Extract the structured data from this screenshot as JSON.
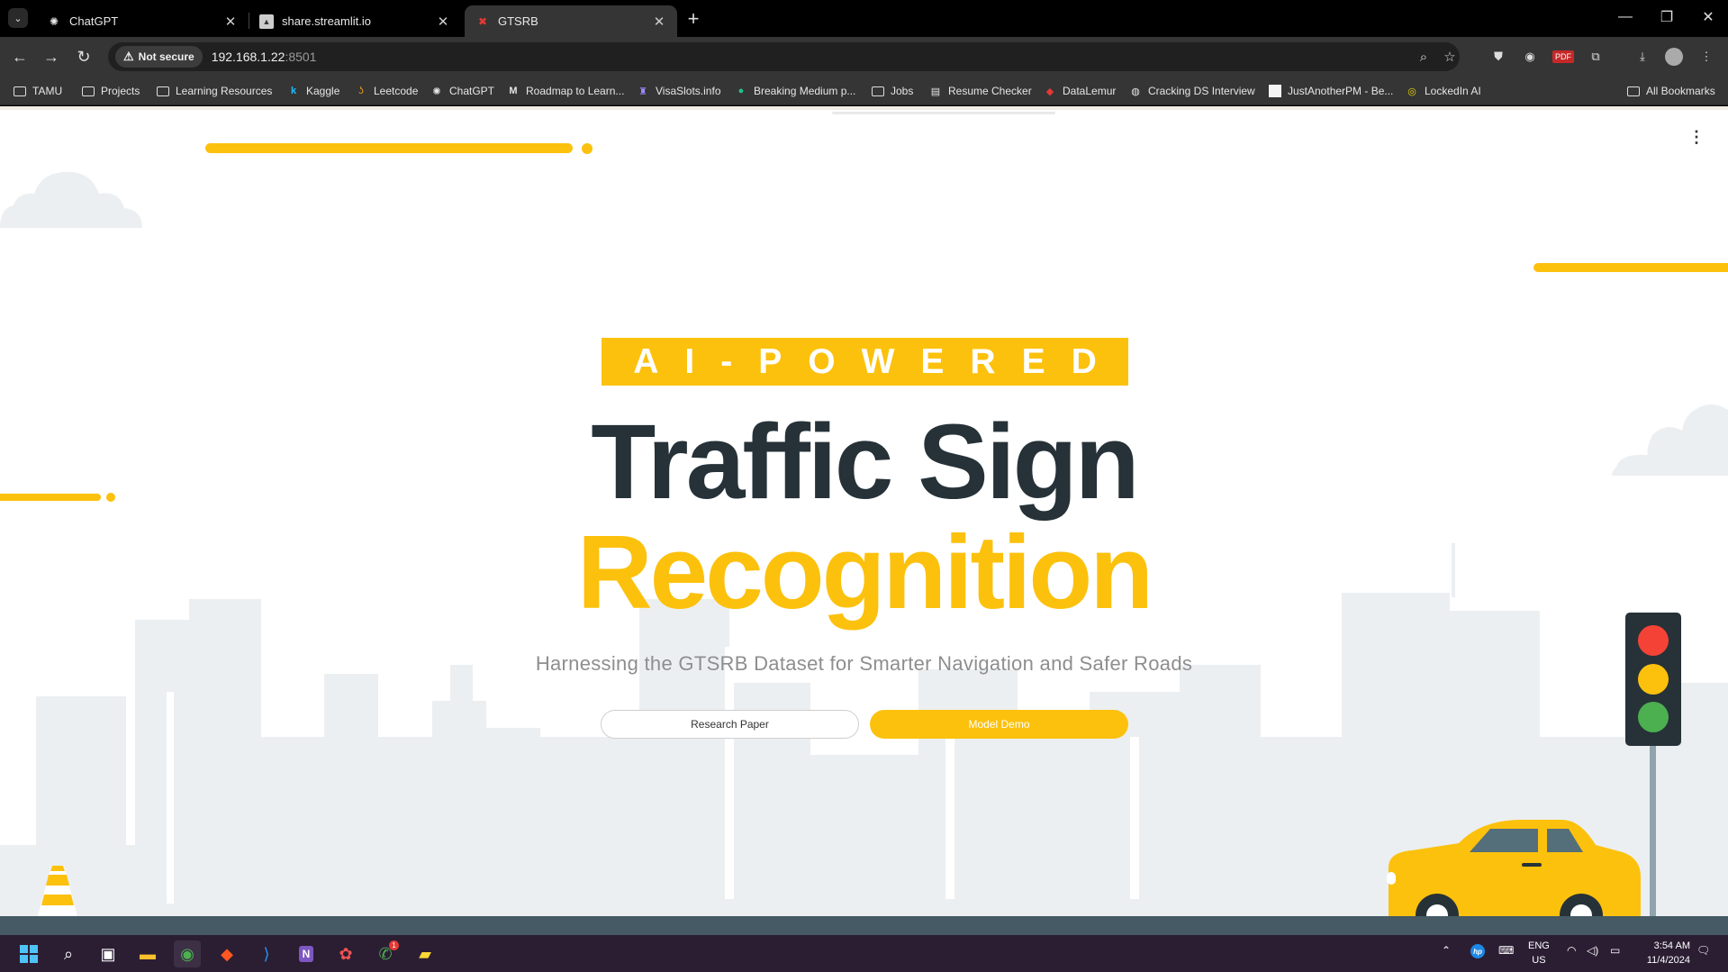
{
  "browser": {
    "tabs": [
      {
        "title": "ChatGPT",
        "icon": "chatgpt-icon",
        "active": false
      },
      {
        "title": "share.streamlit.io",
        "icon": "streamlit-icon",
        "active": false
      },
      {
        "title": "GTSRB",
        "icon": "gtsrb-icon",
        "active": true
      }
    ],
    "security_label": "Not secure",
    "url_host": "192.168.1.22",
    "url_port": ":8501",
    "bookmarks": [
      "TAMU",
      "Projects",
      "Learning Resources",
      "Kaggle",
      "Leetcode",
      "ChatGPT",
      "Roadmap to Learn...",
      "VisaSlots.info",
      "Breaking Medium p...",
      "Jobs",
      "Resume Checker",
      "DataLemur",
      "Cracking DS Interview",
      "JustAnotherPM - Be...",
      "LockedIn AI"
    ],
    "all_bookmarks": "All Bookmarks"
  },
  "hero": {
    "badge": "AI-POWERED",
    "title_line1": "Traffic Sign",
    "title_line2": "Recognition",
    "subtitle": "Harnessing the GTSRB Dataset for Smarter Navigation and Safer Roads",
    "primary_button": "Model Demo",
    "secondary_button": "Research Paper"
  },
  "colors": {
    "accent": "#fcc10d",
    "title_dark": "#263238",
    "skyline": "#eceff1",
    "ground": "#455a64"
  },
  "taskbar": {
    "lang_top": "ENG",
    "lang_bottom": "US",
    "time": "3:54 AM",
    "date": "11/4/2024",
    "whatsapp_badge": "1"
  }
}
